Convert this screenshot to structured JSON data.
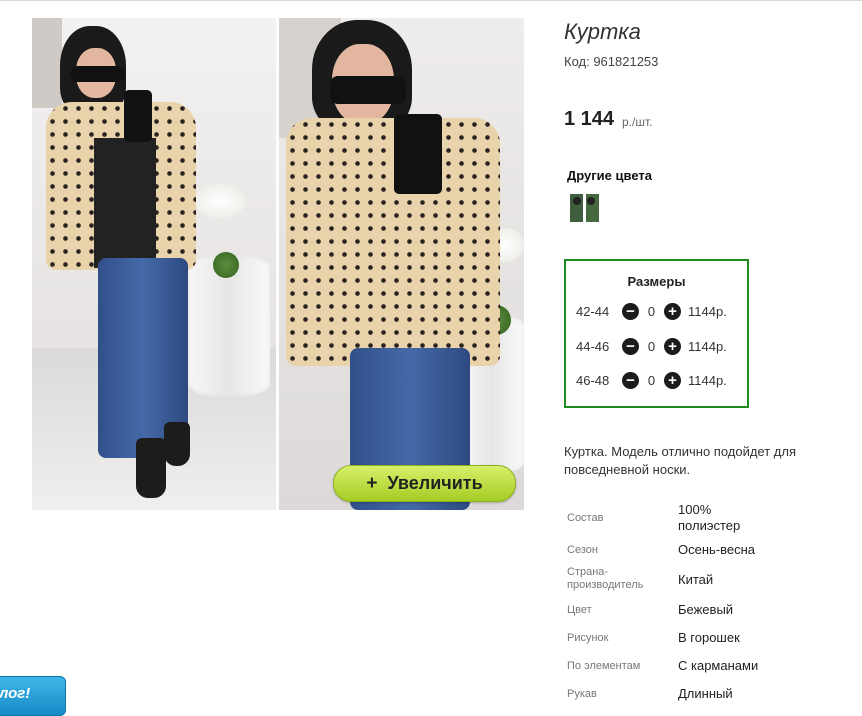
{
  "product": {
    "title": "Куртка",
    "code": "Код: 961821253",
    "price": "1 144",
    "price_unit": "р./шт.",
    "zoom_button": {
      "icon": "plus",
      "label": "Увеличить"
    }
  },
  "colors": {
    "title": "Другие цвета"
  },
  "sizes": {
    "title": "Размеры",
    "rows": [
      {
        "size": "42-44",
        "qty": "0",
        "price": "1144р."
      },
      {
        "size": "44-46",
        "qty": "0",
        "price": "1144р."
      },
      {
        "size": "46-48",
        "qty": "0",
        "price": "1144р."
      }
    ],
    "minus_symbol": "−",
    "plus_symbol": "+",
    "border_color": "#1f8a1f"
  },
  "description": "Куртка. Модель отлично подойдет для повседневной носки.",
  "specs": [
    {
      "key": "Состав",
      "value": "100% полиэстер"
    },
    {
      "key": "Сезон",
      "value": "Осень-весна"
    },
    {
      "key": "Страна-производитель",
      "value": "Китай"
    },
    {
      "key": "Цвет",
      "value": "Бежевый"
    },
    {
      "key": "Рисунок",
      "value": "В горошек"
    },
    {
      "key": "По элементам",
      "value": "С карманами"
    },
    {
      "key": "Рукав",
      "value": "Длинный"
    }
  ],
  "blog_badge": "лог!"
}
